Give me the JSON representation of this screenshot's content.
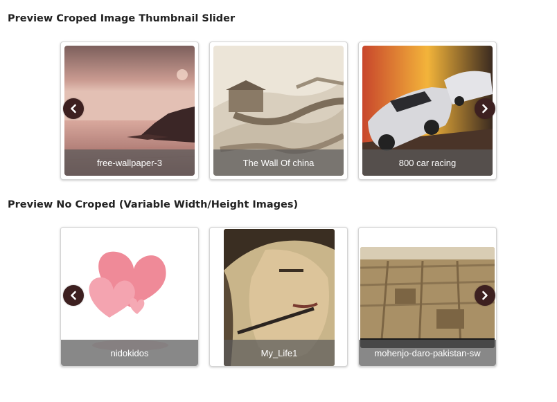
{
  "sections": [
    {
      "title": "Preview Croped Image Thumbnail Slider",
      "items": [
        {
          "caption": "free-wallpaper-3",
          "image": "sunset-sea-rocks"
        },
        {
          "caption": "The Wall Of china",
          "image": "great-wall-winter"
        },
        {
          "caption": "800 car racing",
          "image": "sports-cars-racing"
        }
      ]
    },
    {
      "title": "Preview No Croped (Variable Width/Height Images)",
      "items": [
        {
          "caption": "nidokidos",
          "image": "pink-hearts"
        },
        {
          "caption": "My_Life1",
          "image": "man-portrait-drawing"
        },
        {
          "caption": "mohenjo-daro-pakistan-sw",
          "image": "mohenjo-daro-ruins"
        }
      ]
    }
  ],
  "icons": {
    "prev": "chevron-left-icon",
    "next": "chevron-right-icon"
  },
  "colors": {
    "nav_button": "#3d2020",
    "caption_overlay": "#5a5a5a",
    "card_border": "#d4d4d4"
  }
}
